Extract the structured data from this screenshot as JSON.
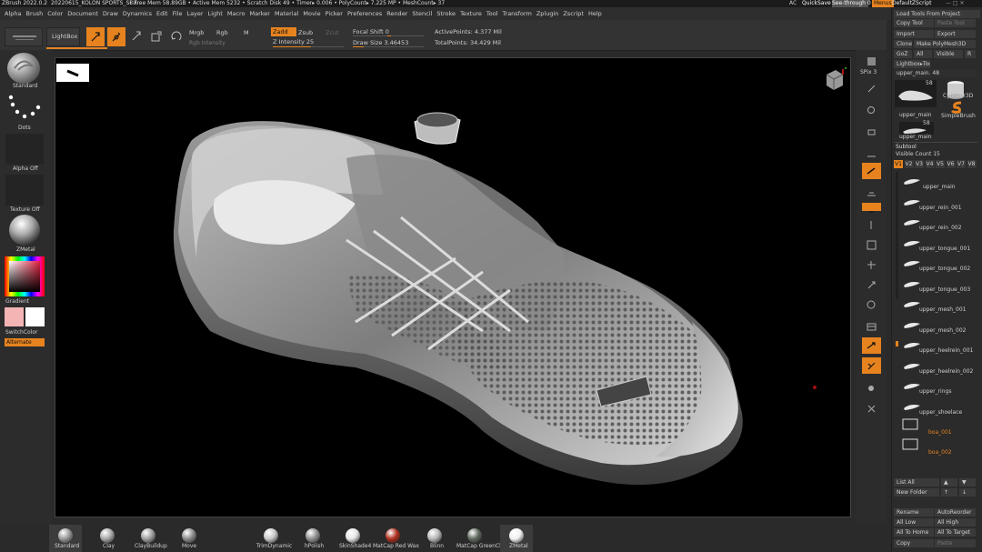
{
  "titlebar": {
    "app": "ZBrush 2022.0.2",
    "doc": "20220615_KOLON SPORTS_SDX",
    "stats": "• Free Mem 58.89GB • Active Mem 5232 • Scratch Disk 49 • Timer▸ 0.006 • PolyCount▸ 7.225 MP • MeshCount▸ 37",
    "ac": "AC",
    "quicksave": "QuickSave",
    "seethrough": "See-through 0",
    "menus": "Menus",
    "script": "DefaultZScript"
  },
  "menus": [
    "Alpha",
    "Brush",
    "Color",
    "Document",
    "Draw",
    "Dynamics",
    "Edit",
    "File",
    "Layer",
    "Light",
    "Macro",
    "Marker",
    "Material",
    "Movie",
    "Picker",
    "Preferences",
    "Render",
    "Stencil",
    "Stroke",
    "Texture",
    "Tool",
    "Transform",
    "Zplugin",
    "Zscript",
    "Help"
  ],
  "toolbar": {
    "lightbox": "LightBox",
    "mrgb": "Mrgb",
    "rgb": "Rgb",
    "m": "M",
    "rgb_intensity": "Rgb Intensity",
    "zadd": "Zadd",
    "zsub": "Zsub",
    "zcut": "Zcut",
    "z_intensity": "Z Intensity 25",
    "focal_shift": "Focal Shift 0",
    "draw_size": "Draw Size 3.46453",
    "active_points": "ActivePoints: 4.377 Mil",
    "total_points": "TotalPoints: 34.429 Mil"
  },
  "left": {
    "brush": "Standard",
    "stroke": "Dots",
    "alpha": "Alpha Off",
    "texture": "Texture Off",
    "material": "ZMetal",
    "gradient": "Gradient",
    "switchcolor": "SwitchColor",
    "alternate": "Alternate",
    "colors": {
      "main": "#f4b4b4",
      "secondary": "#ffffff"
    }
  },
  "right_shelf": {
    "spix": "SPix 3"
  },
  "tray": {
    "load_tools": "Load Tools From Project",
    "copy_tool": "Copy Tool",
    "paste_tool": "Paste Tool",
    "import": "Import",
    "export": "Export",
    "clone": "Clone",
    "make_polymesh": "Make PolyMesh3D",
    "goz": "GoZ",
    "all": "All",
    "visible": "Visible",
    "r": "R",
    "lightbox_tools": "Lightbox▸Tools",
    "current_tool": "upper_main. 48",
    "thumb1_label": "upper_main",
    "thumb1_count": "58",
    "thumb2_label": "Cylinder3D",
    "thumb3_label": "SimpleBrush",
    "thumb4_label": "upper_main",
    "thumb4_count": "58",
    "subtool": "Subtool",
    "visible_count": "Visible Count 15",
    "versions": [
      "V1",
      "V2",
      "V3",
      "V4",
      "V5",
      "V6",
      "V7",
      "V8"
    ],
    "subtools": [
      "upper_main",
      "upper_rein_001",
      "upper_rein_002",
      "upper_tongue_001",
      "upper_tongue_002",
      "upper_tongue_003",
      "upper_mesh_001",
      "upper_mesh_002",
      "upper_heelrein_001",
      "upper_heelrein_002",
      "upper_rings",
      "upper_shoelace"
    ],
    "folders": [
      "boa_001",
      "boa_002"
    ],
    "list_all": "List All",
    "new_folder": "New Folder",
    "rename": "Rename",
    "autoreorder": "AutoReorder",
    "all_low": "All Low",
    "all_high": "All High",
    "all_to_home": "All To Home",
    "all_to_target": "All To Target",
    "copy": "Copy",
    "paste": "Paste"
  },
  "bottom_materials": [
    {
      "label": "Standard",
      "color": "#9a9a9a"
    },
    {
      "label": "Clay",
      "color": "#a8a8a8"
    },
    {
      "label": "ClayBuildup",
      "color": "#a0a0a0"
    },
    {
      "label": "Move",
      "color": "#8c8c8c"
    },
    {
      "label": "TrimDynamic",
      "color": "#c8c8c8"
    },
    {
      "label": "hPolish",
      "color": "#909090"
    },
    {
      "label": "SkinShade4",
      "color": "#e4e4e4"
    },
    {
      "label": "MatCap Red Wax",
      "color": "#b03020"
    },
    {
      "label": "Blinn",
      "color": "#b8b8b8"
    },
    {
      "label": "MatCap GreenCl",
      "color": "#606a5e"
    },
    {
      "label": "ZMetal",
      "color": "#f0f0f0"
    }
  ],
  "accent": "#e6831f"
}
